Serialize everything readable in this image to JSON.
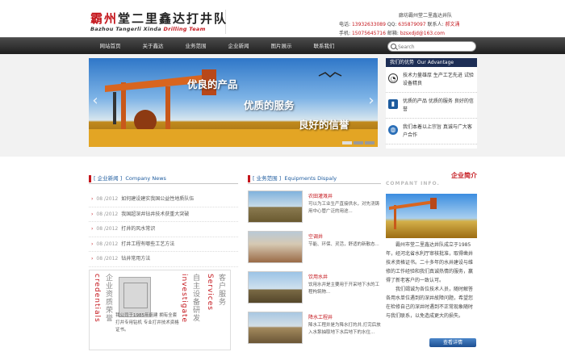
{
  "header": {
    "logo_cn_a": "霸州",
    "logo_cn_b": "堂二里鑫达打井队",
    "logo_en_a": "Bazhou Tangerli Xinda ",
    "logo_en_b": "Drilling Team",
    "address": "廊坊霸州堂二里鑫达井队",
    "phone_label": "电话:",
    "phone": "13932633089",
    "qq_label": "QQ:",
    "qq": "635879097",
    "contact_label": "联系人:",
    "contact": "郝文涌",
    "mobile_label": "手机:",
    "mobile": "15075645716",
    "email_label": "邮箱:",
    "email": "bzsxdjd@163.com"
  },
  "nav": {
    "items": [
      "网站首页",
      "关于鑫达",
      "业务范围",
      "企业新闻",
      "图片展示",
      "联系我们"
    ],
    "search_placeholder": "Search"
  },
  "banner": {
    "line1": "优良的产品",
    "line2": "优质的服务",
    "line3": "良好的信誉",
    "prev": "‹",
    "next": "›"
  },
  "advantage": {
    "title_cn": "我们的优势",
    "title_en": "Our Advantage",
    "items": [
      {
        "icon": "gauge-icon",
        "text": "技术力量雄厚 生产工艺先进 试验设备精良"
      },
      {
        "icon": "chart-icon",
        "text": "优质的产品 优质的服务 良好的信誉"
      },
      {
        "icon": "globe-icon",
        "text": "我们本着以上宗旨 真诚与广大客户合作"
      }
    ]
  },
  "news": {
    "title_cn": "企业新闻",
    "title_en": "Company News",
    "items": [
      {
        "date": "08 /2012",
        "title": "如何建设建实我国公益性地质队伍"
      },
      {
        "date": "08 /2012",
        "title": "我国超深井钻井技术获重大突破"
      },
      {
        "date": "08 /2012",
        "title": "打井的风水常识"
      },
      {
        "date": "08 /2012",
        "title": "打井工程有哪些工艺方法"
      },
      {
        "date": "08 /2012",
        "title": "钻井常用方法"
      }
    ]
  },
  "credentials": {
    "label_a": "credentials",
    "label_b": "企业资质荣誉",
    "label_c": "investigate",
    "label_d": "自主设备研发",
    "label_e": "Services",
    "label_f": "客户服务",
    "desc": "我公司于1985年组建 拥有全套打井专用钻机 专业打井技术资格证书。"
  },
  "equipment": {
    "title_cn": "业务范围",
    "title_en": "Equipments Dispaly",
    "items": [
      {
        "title": "农田灌溉井",
        "desc": "可以为工业生产直接供水，对先浇铸用中心管广泛的用途..."
      },
      {
        "title": "空调井",
        "desc": "节能、环保、灵活，舒适的新散态..."
      },
      {
        "title": "饮用水井",
        "desc": "饮用水井是主要用于开采地下水的工程构筑物..."
      },
      {
        "title": "降水工程井",
        "desc": "降水工程井是为降水打的井,打完后放入水泵抽取地下水后地下的水位..."
      }
    ]
  },
  "intro": {
    "title": "企业简介",
    "title_en": "COMPANT INFO.",
    "p1": "霸州市堂二里鑫达井队成立于1985年，经河北省水利厅审核批准，取得凿井技术资格证书。二十多年的水井建设与维修的工作经验和我们真诚热情的服务，赢得了新老客户的一致认可。",
    "p2": "我们竭诚为各位技术人员，随时解答各用水单位遇到的深井故障问题，希望您在检修自己的深井时遇到不正常现象随时与我们联系，以免造成更大的损失。",
    "more": "查看详情"
  },
  "colors": {
    "accent": "#c4161c",
    "nav": "#2b2b2b",
    "blue": "#1d5b9e"
  }
}
